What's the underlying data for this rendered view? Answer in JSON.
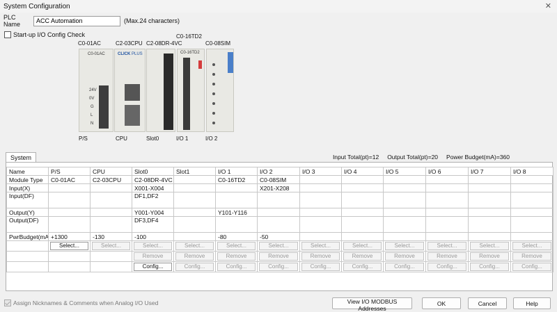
{
  "window": {
    "title": "System Configuration"
  },
  "plc": {
    "label": "PLC Name",
    "value": "ACC Automation",
    "hint": "(Max.24 characters)"
  },
  "startup_check": {
    "label": "Start-up I/O Config Check",
    "checked": false
  },
  "hardware": {
    "modules": [
      {
        "top_label": "C0-01AC",
        "tag": "C0-01AC",
        "bottom_label": "P/S"
      },
      {
        "top_label": "C2-03CPU",
        "tag": "",
        "bottom_label": "CPU"
      },
      {
        "top_label": "C2-08DR-4VC",
        "tag": "",
        "bottom_label": "Slot0"
      },
      {
        "top_label": "C0-16TD2",
        "tag": "C0-16TD2",
        "bottom_label": "I/O 1"
      },
      {
        "top_label": "C0-08SIM",
        "tag": "",
        "bottom_label": "I/O 2"
      }
    ],
    "ps_terminals": [
      "24V",
      "0V",
      "G",
      "L",
      "N"
    ],
    "cpu_brand": "CLICK",
    "cpu_brand_sub": "PLUS"
  },
  "tab": {
    "label": "System"
  },
  "totals": {
    "input": "Input Total(pt)=12",
    "output": "Output Total(pt)=20",
    "power": "Power Budget(mA)=360"
  },
  "grid": {
    "columns": [
      "Name",
      "P/S",
      "CPU",
      "Slot0",
      "Slot1",
      "I/O 1",
      "I/O 2",
      "I/O 3",
      "I/O 4",
      "I/O 5",
      "I/O 6",
      "I/O 7",
      "I/O 8"
    ],
    "rows": [
      {
        "name": "Module Type",
        "cells": [
          "C0-01AC",
          "C2-03CPU",
          "C2-08DR-4VC",
          "",
          "C0-16TD2",
          "C0-08SIM",
          "",
          "",
          "",
          "",
          "",
          ""
        ]
      },
      {
        "name": "Input(X)",
        "cells": [
          "",
          "",
          "X001-X004",
          "",
          "",
          "X201-X208",
          "",
          "",
          "",
          "",
          "",
          ""
        ]
      },
      {
        "name": "Input(DF)",
        "cells": [
          "",
          "",
          "DF1,DF2",
          "",
          "",
          "",
          "",
          "",
          "",
          "",
          "",
          ""
        ]
      },
      {
        "name": "Output(Y)",
        "cells": [
          "",
          "",
          "Y001-Y004",
          "",
          "Y101-Y116",
          "",
          "",
          "",
          "",
          "",
          "",
          ""
        ]
      },
      {
        "name": "Output(DF)",
        "cells": [
          "",
          "",
          "DF3,DF4",
          "",
          "",
          "",
          "",
          "",
          "",
          "",
          "",
          ""
        ]
      },
      {
        "name": "PwrBudget(mA)",
        "cells": [
          "+1300",
          "-130",
          "-100",
          "",
          "-80",
          "-50",
          "",
          "",
          "",
          "",
          "",
          ""
        ]
      }
    ],
    "select_label": "Select...",
    "remove_label": "Remove",
    "config_label": "Config..."
  },
  "footer": {
    "nickname_check": "Assign Nicknames & Comments when Analog I/O Used",
    "modbus_button": "View I/O MODBUS Addresses",
    "ok_button": "OK",
    "cancel_button": "Cancel",
    "help_button": "Help"
  }
}
